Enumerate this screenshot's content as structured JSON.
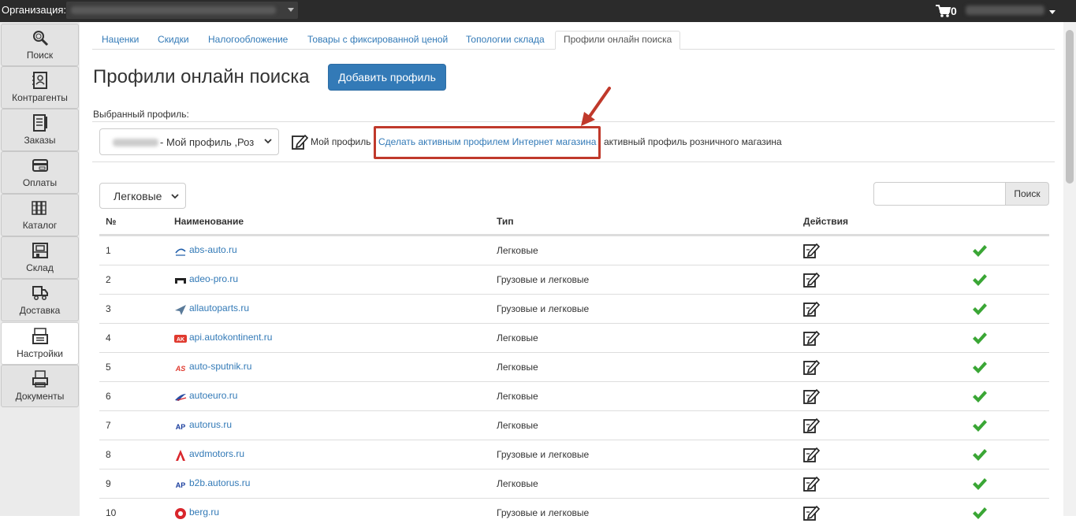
{
  "topbar": {
    "org_label": "Организация:",
    "cart_count": "0"
  },
  "sidebar": {
    "items": [
      {
        "label": "Поиск",
        "icon": "search-icon"
      },
      {
        "label": "Контрагенты",
        "icon": "contacts-icon"
      },
      {
        "label": "Заказы",
        "icon": "orders-icon"
      },
      {
        "label": "Оплаты",
        "icon": "payments-icon"
      },
      {
        "label": "Каталог",
        "icon": "catalog-icon"
      },
      {
        "label": "Склад",
        "icon": "warehouse-icon"
      },
      {
        "label": "Доставка",
        "icon": "delivery-icon"
      },
      {
        "label": "Настройки",
        "icon": "settings-icon",
        "active": true
      },
      {
        "label": "Документы",
        "icon": "documents-icon"
      }
    ]
  },
  "tabs": [
    {
      "label": "Наценки"
    },
    {
      "label": "Скидки"
    },
    {
      "label": "Налогообложение"
    },
    {
      "label": "Товары с фиксированной ценой"
    },
    {
      "label": "Топологии склада"
    },
    {
      "label": "Профили онлайн поиска",
      "active": true
    }
  ],
  "page": {
    "title": "Профили онлайн поиска",
    "add_button": "Добавить профиль",
    "selected_profile_label": "Выбранный профиль:",
    "profile_select_value": "- Мой профиль ,Роз",
    "my_profile": "Мой профиль",
    "make_active_link": "Сделать активным профилем Интернет магазина",
    "retail_text": "активный профиль розничного магазина",
    "type_filter": "Легковые",
    "search_button": "Поиск",
    "search_placeholder": ""
  },
  "table": {
    "headers": {
      "num": "№",
      "name": "Наименование",
      "type": "Тип",
      "actions": "Действия"
    },
    "rows": [
      {
        "num": "1",
        "name": "abs-auto.ru",
        "type": "Легковые",
        "logo_color": "#1a5aa8"
      },
      {
        "num": "2",
        "name": "adeo-pro.ru",
        "type": "Грузовые и легковые",
        "logo_color": "#222222"
      },
      {
        "num": "3",
        "name": "allautoparts.ru",
        "type": "Грузовые и легковые",
        "logo_color": "#5a7a99"
      },
      {
        "num": "4",
        "name": "api.autokontinent.ru",
        "type": "Легковые",
        "logo_color": "#e03a2f"
      },
      {
        "num": "5",
        "name": "auto-sputnik.ru",
        "type": "Легковые",
        "logo_color": "#e03a2f"
      },
      {
        "num": "6",
        "name": "autoeuro.ru",
        "type": "Легковые",
        "logo_color": "#2b4fa3"
      },
      {
        "num": "7",
        "name": "autorus.ru",
        "type": "Легковые",
        "logo_color": "#1c3f9e"
      },
      {
        "num": "8",
        "name": "avdmotors.ru",
        "type": "Грузовые и легковые",
        "logo_color": "#d9262c"
      },
      {
        "num": "9",
        "name": "b2b.autorus.ru",
        "type": "Легковые",
        "logo_color": "#1c3f9e"
      },
      {
        "num": "10",
        "name": "berg.ru",
        "type": "Грузовые и легковые",
        "logo_color": "#d9262c"
      }
    ]
  },
  "colors": {
    "accent": "#337ab7",
    "check": "#3aa635",
    "highlight": "#c0392b",
    "topbar": "#2b2b2b"
  }
}
